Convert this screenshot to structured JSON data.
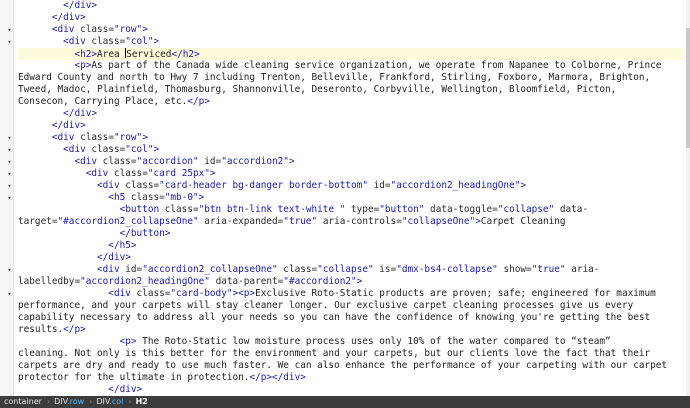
{
  "editor": {
    "lines": [
      {
        "fold": false,
        "segs": [
          [
            "tag",
            "        </div>"
          ]
        ]
      },
      {
        "fold": false,
        "segs": [
          [
            "tag",
            "      </div>"
          ]
        ]
      },
      {
        "fold": true,
        "segs": [
          [
            "tag",
            "      <div "
          ],
          [
            "attr",
            "class="
          ],
          [
            "val",
            "\"row\""
          ],
          [
            "tag",
            ">"
          ]
        ]
      },
      {
        "fold": true,
        "segs": [
          [
            "tag",
            "        <div "
          ],
          [
            "attr",
            "class="
          ],
          [
            "val",
            "\"col\""
          ],
          [
            "tag",
            ">"
          ]
        ]
      },
      {
        "fold": false,
        "active": true,
        "segs": [
          [
            "tag",
            "          <h2>"
          ],
          [
            "txt",
            "Area "
          ],
          [
            "caret",
            ""
          ],
          [
            "txt",
            "Serviced"
          ],
          [
            "tag",
            "</h2>"
          ]
        ]
      },
      {
        "fold": false,
        "segs": [
          [
            "tag",
            "          <p>"
          ],
          [
            "txt",
            "As part of the Canada wide cleaning service organization, we operate from Napanee to Colborne, Prince"
          ]
        ]
      },
      {
        "fold": false,
        "segs": [
          [
            "txt",
            "Edward County and north to Hwy 7 including Trenton, Belleville, Frankford, Stirling, Foxboro, Marmora, Brighton,"
          ]
        ]
      },
      {
        "fold": false,
        "segs": [
          [
            "txt",
            "Tweed, Madoc, Plainfield, Thomasburg, Shannonville, Deseronto, Corbyville, Wellington, Bloomfield, Picton,"
          ]
        ]
      },
      {
        "fold": false,
        "segs": [
          [
            "txt",
            "Consecon, Carrying Place, etc."
          ],
          [
            "tag",
            "</p>"
          ]
        ]
      },
      {
        "fold": false,
        "segs": [
          [
            "tag",
            "        </div>"
          ]
        ]
      },
      {
        "fold": false,
        "segs": [
          [
            "tag",
            "      </div>"
          ]
        ]
      },
      {
        "fold": true,
        "segs": [
          [
            "tag",
            "      <div "
          ],
          [
            "attr",
            "class="
          ],
          [
            "val",
            "\"row\""
          ],
          [
            "tag",
            ">"
          ]
        ]
      },
      {
        "fold": true,
        "segs": [
          [
            "tag",
            "        <div "
          ],
          [
            "attr",
            "class="
          ],
          [
            "val",
            "\"col\""
          ],
          [
            "tag",
            ">"
          ]
        ]
      },
      {
        "fold": true,
        "segs": [
          [
            "tag",
            "          <div "
          ],
          [
            "attr",
            "class="
          ],
          [
            "val",
            "\"accordion\""
          ],
          [
            "attr",
            " id="
          ],
          [
            "val",
            "\"accordion2\""
          ],
          [
            "tag",
            ">"
          ]
        ]
      },
      {
        "fold": true,
        "segs": [
          [
            "tag",
            "            <div "
          ],
          [
            "attr",
            "class="
          ],
          [
            "val",
            "\"card 25px\""
          ],
          [
            "tag",
            ">"
          ]
        ]
      },
      {
        "fold": true,
        "segs": [
          [
            "tag",
            "              <div "
          ],
          [
            "attr",
            "class="
          ],
          [
            "val",
            "\"card-header bg-danger border-bottom\""
          ],
          [
            "attr",
            " id="
          ],
          [
            "val",
            "\"accordion2_headingOne\""
          ],
          [
            "tag",
            ">"
          ]
        ]
      },
      {
        "fold": true,
        "segs": [
          [
            "tag",
            "                <h5 "
          ],
          [
            "attr",
            "class="
          ],
          [
            "val",
            "\"mb-0\""
          ],
          [
            "tag",
            ">"
          ]
        ]
      },
      {
        "fold": false,
        "segs": [
          [
            "tag",
            "                  <button "
          ],
          [
            "attr",
            "class="
          ],
          [
            "val",
            "\"btn btn-link text-white \""
          ],
          [
            "attr",
            " type="
          ],
          [
            "val",
            "\"button\""
          ],
          [
            "attr",
            " data-toggle="
          ],
          [
            "val",
            "\"collapse\""
          ],
          [
            "attr",
            " data-"
          ]
        ]
      },
      {
        "fold": false,
        "segs": [
          [
            "attr",
            "target="
          ],
          [
            "val",
            "\"#accordion2_collapseOne\""
          ],
          [
            "attr",
            " aria-expanded="
          ],
          [
            "val",
            "\"true\""
          ],
          [
            "attr",
            " aria-controls="
          ],
          [
            "val",
            "\"collapseOne\""
          ],
          [
            "tag",
            ">"
          ],
          [
            "txt",
            "Carpet Cleaning"
          ]
        ]
      },
      {
        "fold": false,
        "segs": [
          [
            "tag",
            "                  </button>"
          ]
        ]
      },
      {
        "fold": false,
        "segs": [
          [
            "tag",
            "                </h5>"
          ]
        ]
      },
      {
        "fold": false,
        "segs": [
          [
            "tag",
            "              </div>"
          ]
        ]
      },
      {
        "fold": true,
        "segs": [
          [
            "tag",
            "              <div "
          ],
          [
            "attr",
            "id="
          ],
          [
            "val",
            "\"accordion2_collapseOne\""
          ],
          [
            "attr",
            " class="
          ],
          [
            "val",
            "\"collapse\""
          ],
          [
            "attr",
            " is="
          ],
          [
            "val",
            "\"dmx-bs4-collapse\""
          ],
          [
            "attr",
            " show="
          ],
          [
            "val",
            "\"true\""
          ],
          [
            "attr",
            " aria-"
          ]
        ]
      },
      {
        "fold": false,
        "segs": [
          [
            "attr",
            "labelledby="
          ],
          [
            "val",
            "\"accordion2_headingOne\""
          ],
          [
            "attr",
            " data-parent="
          ],
          [
            "val",
            "\"#accordion2\""
          ],
          [
            "tag",
            ">"
          ]
        ]
      },
      {
        "fold": true,
        "segs": [
          [
            "tag",
            "                <div "
          ],
          [
            "attr",
            "class="
          ],
          [
            "val",
            "\"card-body\""
          ],
          [
            "tag",
            "><p>"
          ],
          [
            "txt",
            "Exclusive Roto-Static products are proven; safe; engineered for maximum"
          ]
        ]
      },
      {
        "fold": false,
        "segs": [
          [
            "txt",
            "performance, and your carpets will stay cleaner longer. Our exclusive carpet cleaning processes give us every"
          ]
        ]
      },
      {
        "fold": false,
        "segs": [
          [
            "txt",
            "capability necessary to address all your needs so you can have the confidence of knowing you're getting the best"
          ]
        ]
      },
      {
        "fold": false,
        "segs": [
          [
            "txt",
            "results."
          ],
          [
            "tag",
            "</p>"
          ]
        ]
      },
      {
        "fold": false,
        "segs": [
          [
            "tag",
            "                  <p>"
          ],
          [
            "txt",
            " The Roto-Static low moisture process uses only 10% of the water compared to “steam”"
          ]
        ]
      },
      {
        "fold": false,
        "segs": [
          [
            "txt",
            "cleaning. Not only is this better for the environment and your carpets, but our clients love the fact that their"
          ]
        ]
      },
      {
        "fold": false,
        "segs": [
          [
            "txt",
            "carpets are dry and ready to use much faster. We can also enhance the performance of your carpeting with our carpet"
          ]
        ]
      },
      {
        "fold": false,
        "segs": [
          [
            "txt",
            "protector for the ultimate in protection."
          ],
          [
            "tag",
            "</p></div>"
          ]
        ]
      },
      {
        "fold": false,
        "segs": [
          [
            "tag",
            "                </div>"
          ]
        ]
      }
    ]
  },
  "statusbar": {
    "crumbs": [
      {
        "tag": "container",
        "cls": "",
        "current": false
      },
      {
        "tag": "DIV",
        "cls": ".row",
        "current": false
      },
      {
        "tag": "DIV",
        "cls": ".col",
        "current": false
      },
      {
        "tag": "H2",
        "cls": "",
        "current": true
      }
    ]
  }
}
